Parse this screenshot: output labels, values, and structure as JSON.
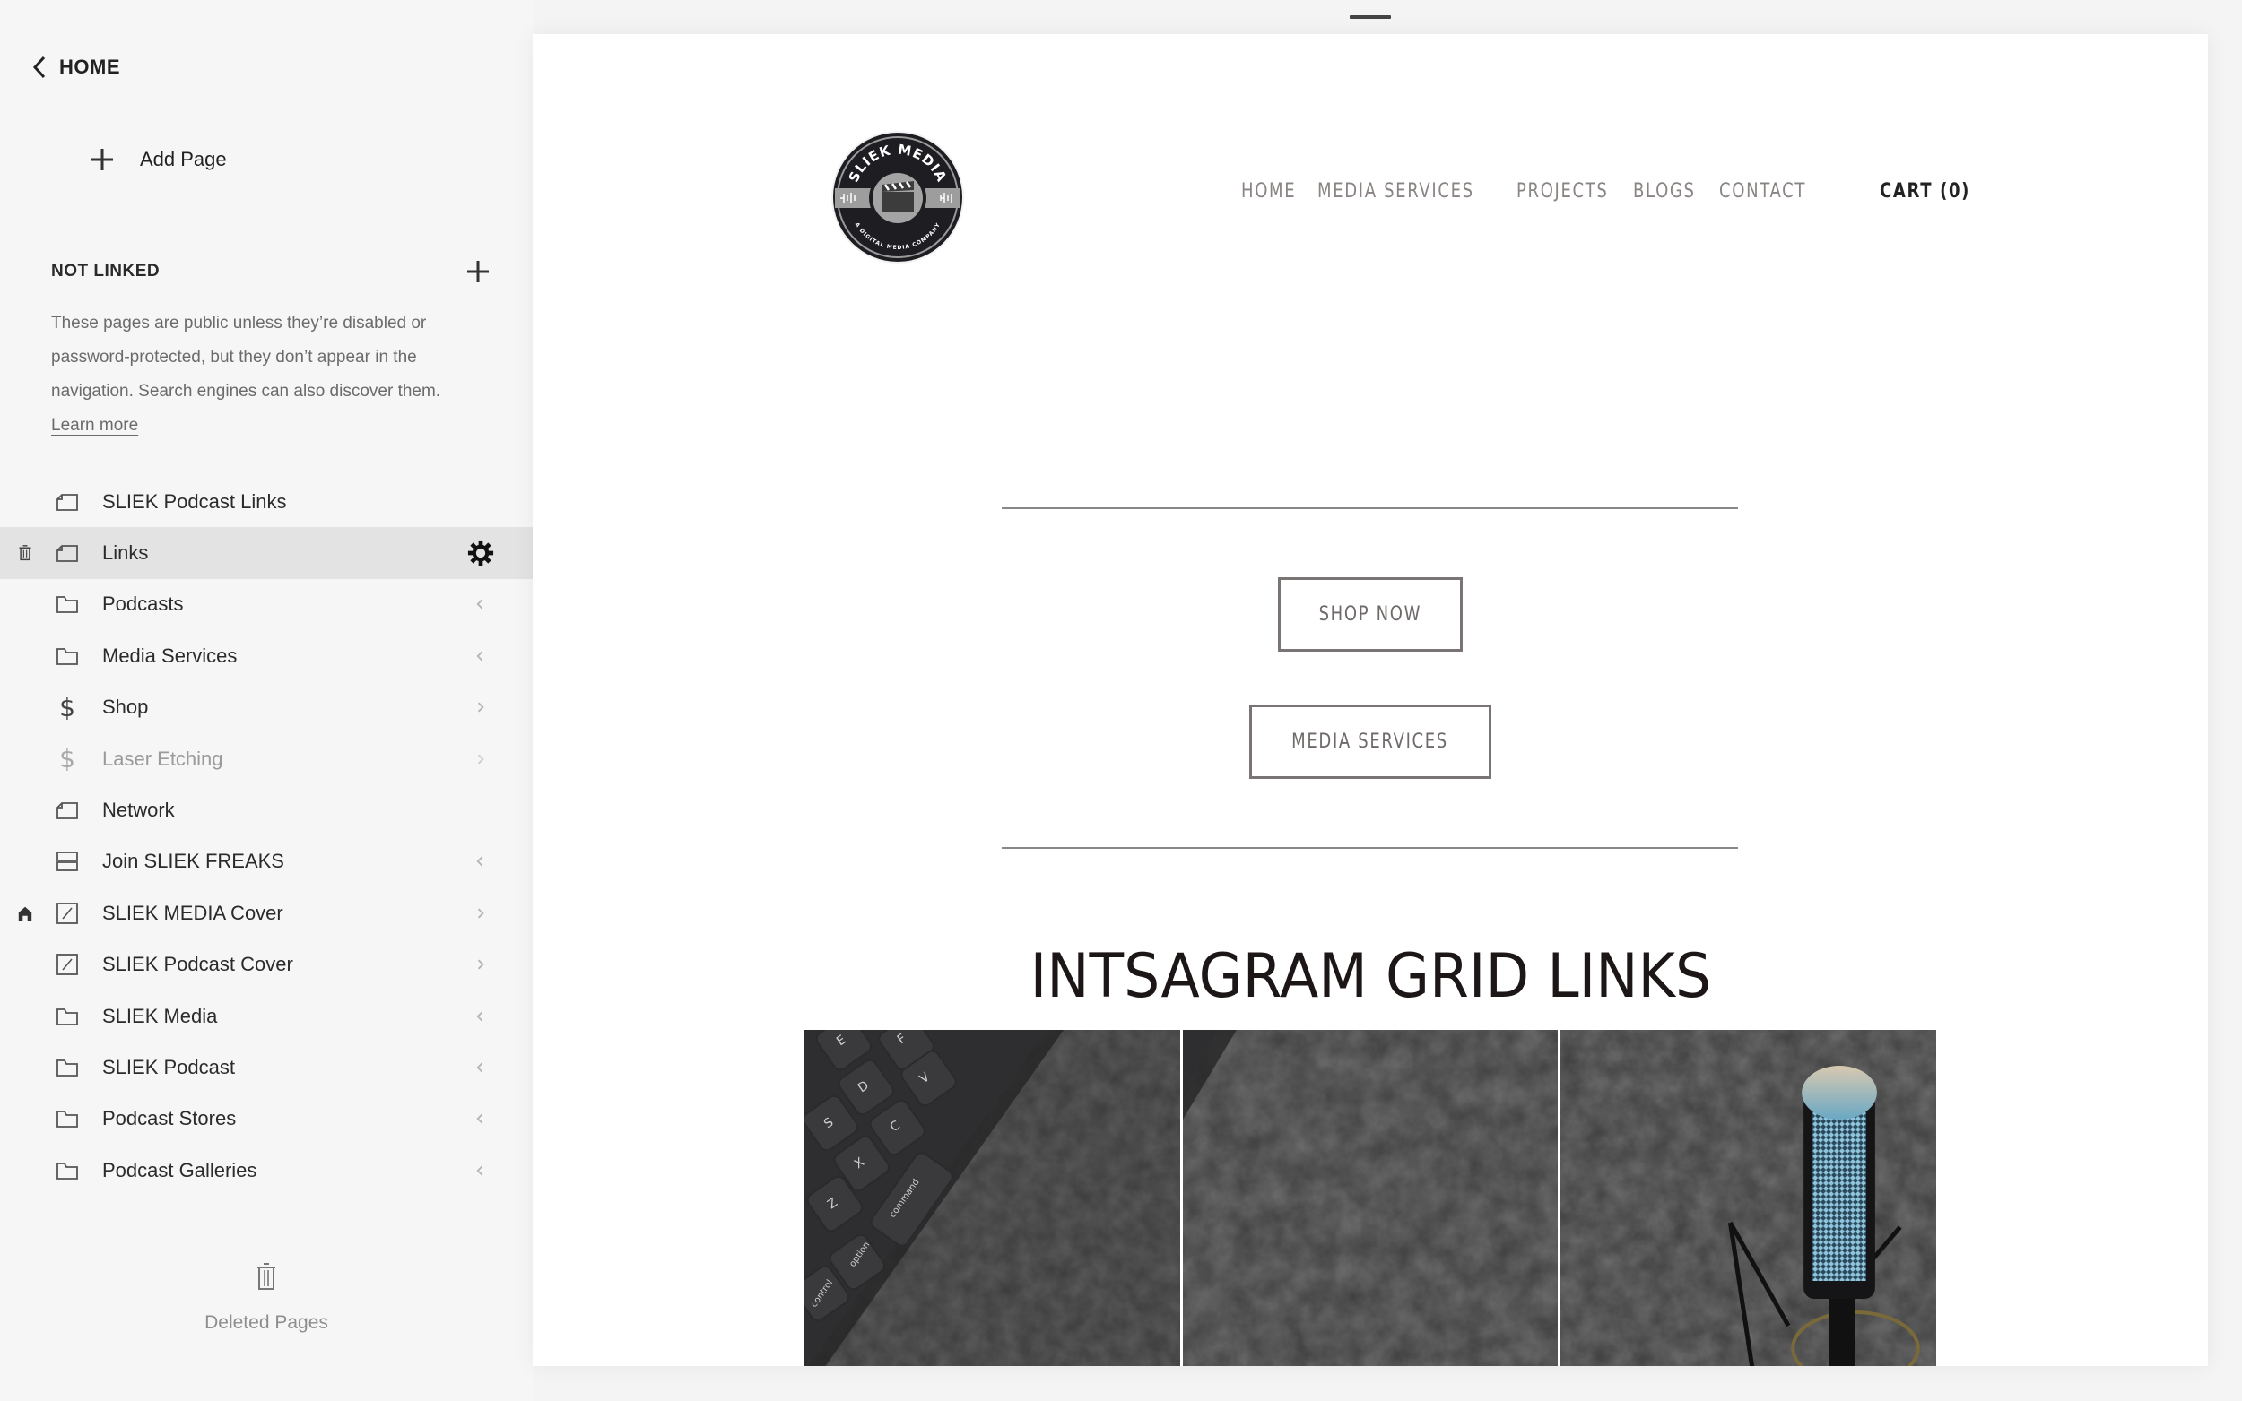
{
  "sidebar": {
    "back_label": "HOME",
    "add_page_label": "Add Page",
    "section_title": "NOT LINKED",
    "section_description": "These pages are public unless they’re disabled or password-protected, but they don’t appear in the navigation. Search engines can also discover them.",
    "learn_more_label": "Learn more",
    "pages": [
      {
        "label": "SLIEK Podcast Links",
        "icon": "page-icon",
        "chevron": null,
        "selected": false,
        "disabled": false,
        "homepage": false
      },
      {
        "label": "Links",
        "icon": "page-icon",
        "chevron": null,
        "selected": true,
        "disabled": false,
        "homepage": false
      },
      {
        "label": "Podcasts",
        "icon": "folder-icon",
        "chevron": "left",
        "selected": false,
        "disabled": false,
        "homepage": false
      },
      {
        "label": "Media Services",
        "icon": "folder-icon",
        "chevron": "left",
        "selected": false,
        "disabled": false,
        "homepage": false
      },
      {
        "label": "Shop",
        "icon": "dollar-icon",
        "chevron": "right",
        "selected": false,
        "disabled": false,
        "homepage": false
      },
      {
        "label": "Laser Etching",
        "icon": "dollar-icon",
        "chevron": "right",
        "selected": false,
        "disabled": true,
        "homepage": false
      },
      {
        "label": "Network",
        "icon": "page-icon",
        "chevron": null,
        "selected": false,
        "disabled": false,
        "homepage": false
      },
      {
        "label": "Join SLIEK FREAKS",
        "icon": "index-icon",
        "chevron": "left",
        "selected": false,
        "disabled": false,
        "homepage": false
      },
      {
        "label": "SLIEK MEDIA Cover",
        "icon": "cover-page-icon",
        "chevron": "right",
        "selected": false,
        "disabled": false,
        "homepage": true
      },
      {
        "label": "SLIEK Podcast Cover",
        "icon": "cover-page-icon",
        "chevron": "right",
        "selected": false,
        "disabled": false,
        "homepage": false
      },
      {
        "label": "SLIEK Media",
        "icon": "folder-icon",
        "chevron": "left",
        "selected": false,
        "disabled": false,
        "homepage": false
      },
      {
        "label": "SLIEK Podcast",
        "icon": "folder-icon",
        "chevron": "left",
        "selected": false,
        "disabled": false,
        "homepage": false
      },
      {
        "label": "Podcast Stores",
        "icon": "folder-icon",
        "chevron": "left",
        "selected": false,
        "disabled": false,
        "homepage": false
      },
      {
        "label": "Podcast Galleries",
        "icon": "folder-icon",
        "chevron": "left",
        "selected": false,
        "disabled": false,
        "homepage": false
      }
    ],
    "deleted_pages_label": "Deleted Pages"
  },
  "preview": {
    "logo": {
      "top_text": "SLIEK MEDIA",
      "bottom_text": "A DIGITAL MEDIA COMPANY"
    },
    "nav": [
      {
        "label": "HOME"
      },
      {
        "label": "MEDIA SERVICES"
      },
      {
        "label": "PROJECTS"
      },
      {
        "label": "BLOGS"
      },
      {
        "label": "CONTACT"
      }
    ],
    "cart_label": "CART (0)",
    "buttons": {
      "shop_now": "SHOP NOW",
      "media_services": "MEDIA SERVICES"
    },
    "heading": "INTSAGRAM GRID LINKS",
    "grid_images": [
      {
        "subject": "keyboard",
        "keys": [
          "E",
          "F",
          "D",
          "S",
          "C",
          "V",
          "X",
          "Z",
          "control",
          "option",
          "command"
        ]
      },
      {
        "subject": "concrete texture"
      },
      {
        "subject": "microphone"
      }
    ]
  },
  "colors": {
    "sidebar_bg": "#f6f6f6",
    "selected_row_bg": "#e3e3e3",
    "nav_text": "#8a8483",
    "button_border": "#7a7574",
    "heading_text": "#1c1616"
  }
}
